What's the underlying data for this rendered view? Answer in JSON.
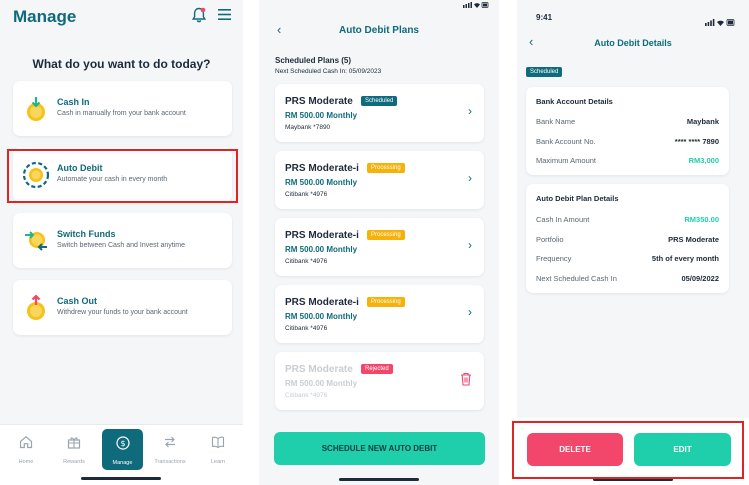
{
  "manage": {
    "title": "Manage",
    "question": "What do you want to do today?",
    "items": [
      {
        "title": "Cash In",
        "subtitle": "Cash in manually from your bank account"
      },
      {
        "title": "Auto Debit",
        "subtitle": "Automate your cash in every month"
      },
      {
        "title": "Switch Funds",
        "subtitle": "Switch between Cash and Invest anytime"
      },
      {
        "title": "Cash Out",
        "subtitle": "Withdrew your funds to your bank account"
      }
    ],
    "tabs": [
      "Home",
      "Rewards",
      "Manage",
      "Transactions",
      "Learn"
    ]
  },
  "plans": {
    "header": "Auto Debit Plans",
    "scheduled_label": "Scheduled Plans (5)",
    "next_label": "Next Scheduled Cash In: 05/09/2023",
    "cards": [
      {
        "name": "PRS Moderate",
        "status": "Scheduled",
        "amount": "RM 500.00 Monthly",
        "bank": "Maybank *7890"
      },
      {
        "name": "PRS Moderate-i",
        "status": "Processing",
        "amount": "RM 500.00 Monthly",
        "bank": "Citibank *4976"
      },
      {
        "name": "PRS Moderate-i",
        "status": "Processing",
        "amount": "RM 500.00 Monthly",
        "bank": "Citibank *4976"
      },
      {
        "name": "PRS Moderate-i",
        "status": "Processing",
        "amount": "RM 500.00 Monthly",
        "bank": "Citibank *4976"
      },
      {
        "name": "PRS Moderate",
        "status": "Rejected",
        "amount": "RM 500.00 Monthly",
        "bank": "Citibank *4976"
      }
    ],
    "button": "SCHEDULE NEW AUTO DEBIT"
  },
  "details": {
    "time": "9:41",
    "header": "Auto Debit Details",
    "tag": "Scheduled",
    "bank_section": {
      "title": "Bank Account Details",
      "rows": [
        {
          "label": "Bank Name",
          "value": "Maybank"
        },
        {
          "label": "Bank Account No.",
          "value": "**** **** 7890"
        },
        {
          "label": "Maximum Amount",
          "value": "RM3,000"
        }
      ]
    },
    "plan_section": {
      "title": "Auto Debit Plan Details",
      "rows": [
        {
          "label": "Cash In Amount",
          "value": "RM350.00"
        },
        {
          "label": "Portfolio",
          "value": "PRS Moderate"
        },
        {
          "label": "Frequency",
          "value": "5th of every month"
        },
        {
          "label": "Next Scheduled Cash In",
          "value": "05/09/2022"
        }
      ]
    },
    "delete_label": "DELETE",
    "edit_label": "EDIT"
  },
  "colors": {
    "brand": "#0f6a7c",
    "accent": "#1fcfab",
    "danger": "#f2476a",
    "warning": "#f6b20a",
    "highlight": "#e02424"
  }
}
